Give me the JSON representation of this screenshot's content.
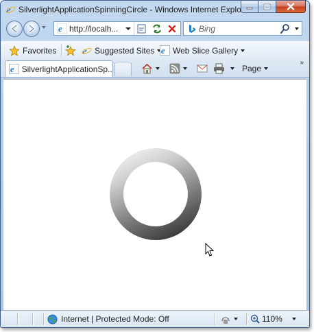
{
  "window": {
    "title": "SilverlightApplicationSpinningCircle - Windows Internet Explorer"
  },
  "addressbar": {
    "url": "http://localh..."
  },
  "search": {
    "placeholder": "Bing"
  },
  "favorites_bar": {
    "favorites_label": "Favorites",
    "suggested_sites_label": "Suggested Sites",
    "web_slice_gallery_label": "Web Slice Gallery"
  },
  "tabs": [
    {
      "label": "SilverlightApplicationSp..."
    }
  ],
  "command_bar": {
    "page_label": "Page"
  },
  "statusbar": {
    "zone_text": "Internet | Protected Mode: Off",
    "zoom_text": "110%"
  },
  "colors": {
    "window_frame": "#aac6e6",
    "close_button": "#c43b1d",
    "content_background": "#ffffff"
  },
  "icons": [
    "ie-logo-icon",
    "minimize-icon",
    "maximize-icon",
    "close-icon",
    "back-icon",
    "forward-icon",
    "compatibility-view-icon",
    "refresh-icon",
    "stop-icon",
    "bing-icon",
    "search-icon",
    "favorites-star-icon",
    "add-favorites-icon",
    "home-icon",
    "rss-feed-icon",
    "mail-icon",
    "print-icon",
    "chevron-right-icon",
    "globe-icon",
    "security-icon",
    "zoom-icon",
    "mouse-cursor-icon"
  ]
}
